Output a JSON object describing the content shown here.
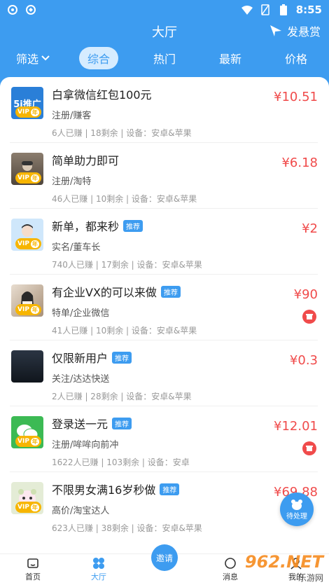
{
  "status": {
    "time": "8:55",
    "icons": [
      "notify-icon",
      "notify-icon-2",
      "wifi-icon",
      "sim-icon",
      "battery-icon"
    ]
  },
  "header": {
    "title": "大厅",
    "reward_label": "发悬赏"
  },
  "tabs": [
    {
      "label": "筛选",
      "dropdown": true
    },
    {
      "label": "综合",
      "active": true
    },
    {
      "label": "热门"
    },
    {
      "label": "最新"
    },
    {
      "label": "价格"
    }
  ],
  "tasks": [
    {
      "title": "白拿微信红包100元",
      "tag": "",
      "sub": "注册/赚客",
      "meta": "6人已赚 | 18剩余 | 设备：安卓&苹果",
      "price": "¥10.51",
      "avatar_text": "5i推广",
      "avatar_color": "#2a7fd8",
      "badge": true
    },
    {
      "title": "简单助力即可",
      "tag": "",
      "sub": "注册/淘特",
      "meta": "46人已赚 | 10剩余 | 设备：安卓&苹果",
      "price": "¥6.18",
      "avatar_text": "",
      "avatar_color": "#6b5e52",
      "badge": true
    },
    {
      "title": "新单，都来秒",
      "tag": "推荐",
      "sub": "实名/董车长",
      "meta": "740人已赚 | 17剩余 | 设备：安卓&苹果",
      "price": "¥2",
      "avatar_text": "",
      "avatar_color": "#cfe7fb",
      "badge": true
    },
    {
      "title": "有企业VX的可以来做",
      "tag": "推荐",
      "sub": "特单/企业微信",
      "meta": "41人已赚 | 10剩余 | 设备：安卓&苹果",
      "price": "¥90",
      "avatar_text": "",
      "avatar_color": "#c9b8a8",
      "badge": true,
      "red_icon": true
    },
    {
      "title": "仅限新用户",
      "tag": "推荐",
      "sub": "关注/达达快送",
      "meta": "2人已赚 | 28剩余 | 设备：安卓&苹果",
      "price": "¥0.3",
      "avatar_text": "",
      "avatar_color": "#1c2430",
      "badge": false
    },
    {
      "title": "登录送一元",
      "tag": "推荐",
      "sub": "注册/哞哞向前冲",
      "meta": "1622人已赚 | 103剩余 | 设备：安卓",
      "price": "¥12.01",
      "avatar_text": "",
      "avatar_color": "#3cba54",
      "badge": true,
      "red_icon": true
    },
    {
      "title": "不限男女满16岁秒做",
      "tag": "推荐",
      "sub": "高价/淘宝达人",
      "meta": "623人已赚 | 38剩余 | 设备：安卓&苹果",
      "price": "¥69.88",
      "avatar_text": "",
      "avatar_color": "#d9e6c7",
      "badge": true
    }
  ],
  "float_button": {
    "label": "待处理"
  },
  "nav": [
    {
      "label": "首页",
      "icon": "home-icon"
    },
    {
      "label": "大厅",
      "icon": "hall-icon",
      "active": true
    },
    {
      "label": "邀请",
      "icon": "invite-icon"
    },
    {
      "label": "消息",
      "icon": "message-icon"
    },
    {
      "label": "我的",
      "icon": "profile-icon"
    }
  ],
  "vip_label": "VIP",
  "year_label": "年",
  "colors": {
    "brand": "#3d9cf0",
    "price": "#f04b4b",
    "vip": "#f7b500"
  },
  "watermark": {
    "main": "962.NET",
    "sub": "乐游网"
  }
}
